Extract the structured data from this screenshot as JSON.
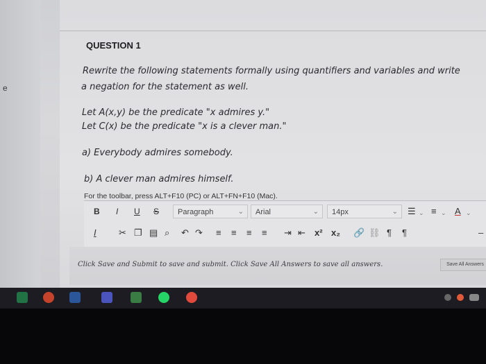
{
  "question": {
    "title": "QUESTION 1",
    "prompt_line1": "Rewrite the following statements formally using quantifiers and variables and write",
    "prompt_line2": "a negation for the statement as well.",
    "def_line1": "Let A(x,y) be the predicate \"x admires y.\"",
    "def_line2": "Let C(x) be the predicate \"x is a clever man.\"",
    "part_a": "a) Everybody admires somebody.",
    "part_b": "b) A clever man admires himself."
  },
  "sidebar": {
    "letter": "e"
  },
  "editor": {
    "toolbar_note": "For the toolbar, press ALT+F10 (PC) or ALT+FN+F10 (Mac).",
    "bold": "B",
    "italic": "I",
    "underline": "U",
    "strike": "S",
    "paragraph_select": "Paragraph",
    "font_select": "Arial",
    "size_select": "14px",
    "superscript": "x²",
    "subscript": "x₂"
  },
  "footer": {
    "instructions": "Click Save and Submit to save and submit. Click Save All Answers to save all answers.",
    "save_all_label": "Save All Answers"
  },
  "colors": {
    "taskbar": "#1c1c22",
    "page": "#e0e0e2"
  }
}
